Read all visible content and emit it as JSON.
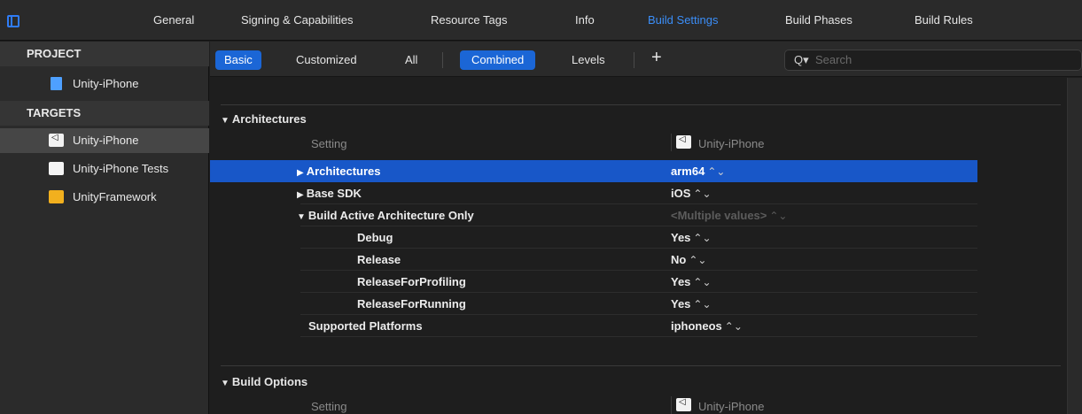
{
  "tabs": [
    "General",
    "Signing & Capabilities",
    "Resource Tags",
    "Info",
    "Build Settings",
    "Build Phases",
    "Build Rules"
  ],
  "active_tab": "Build Settings",
  "sidebar": {
    "project_header": "PROJECT",
    "project_item": "Unity-iPhone",
    "targets_header": "TARGETS",
    "targets": [
      "Unity-iPhone",
      "Unity-iPhone Tests",
      "UnityFramework"
    ]
  },
  "filters": {
    "basic": "Basic",
    "customized": "Customized",
    "all": "All",
    "combined": "Combined",
    "levels": "Levels",
    "add": "+",
    "search_placeholder": "Search"
  },
  "columns": {
    "setting": "Setting",
    "target": "Unity-iPhone"
  },
  "sections": [
    {
      "title": "Architectures",
      "rows": [
        {
          "label": "Architectures",
          "value": "arm64",
          "selected": true,
          "disclosure": "collapsed"
        },
        {
          "label": "Base SDK",
          "value": "iOS",
          "disclosure": "collapsed"
        },
        {
          "label": "Build Active Architecture Only",
          "value": "<Multiple values>",
          "disclosure": "expanded",
          "dim": true
        },
        {
          "label": "Debug",
          "value": "Yes",
          "child": true
        },
        {
          "label": "Release",
          "value": "No",
          "child": true
        },
        {
          "label": "ReleaseForProfiling",
          "value": "Yes",
          "child": true
        },
        {
          "label": "ReleaseForRunning",
          "value": "Yes",
          "child": true
        },
        {
          "label": "Supported Platforms",
          "value": "iphoneos"
        }
      ]
    },
    {
      "title": "Build Options"
    }
  ],
  "colors": {
    "accent": "#1b66d6",
    "selection": "#1857c8",
    "active_tab": "#3b8ef8"
  },
  "icons": {
    "navigator_toggle": "sidebar-toggle-icon",
    "project_file": "project-file-icon",
    "target_app": "unity-app-icon",
    "test_bundle": "test-bundle-icon",
    "framework": "framework-toolbox-icon",
    "search": "search-icon"
  }
}
